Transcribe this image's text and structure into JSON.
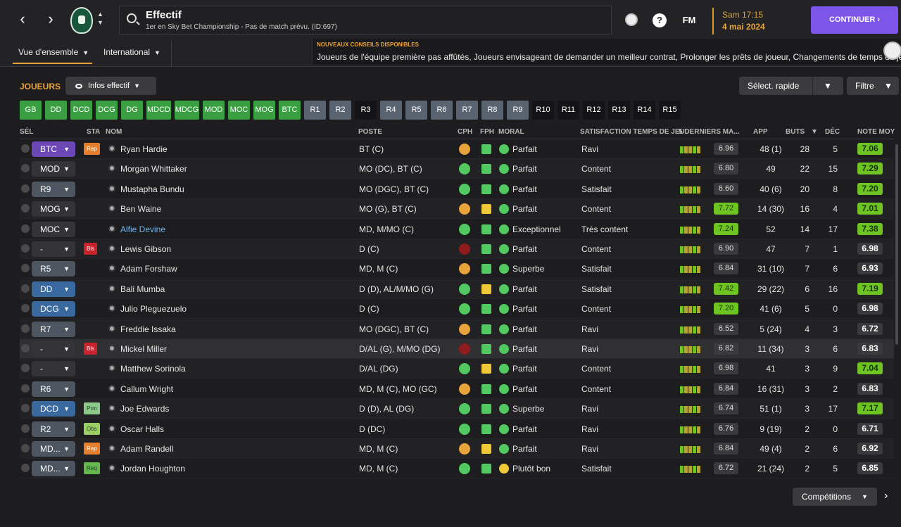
{
  "header": {
    "title": "Effectif",
    "subtitle": "1er en Sky Bet Championship - Pas de match prévu. (ID:697)",
    "time": "Sam 17:15",
    "date": "4 mai 2024",
    "continue_label": "CONTINUER",
    "fm_label": "FM"
  },
  "tabs": [
    {
      "label": "Vue d'ensemble"
    },
    {
      "label": "International"
    }
  ],
  "advice": {
    "title": "NOUVEAUX CONSEILS DISPONIBLES",
    "text": "Joueurs de l'équipe première pas affûtés, Joueurs envisageant de demander un meilleur contrat, Prolonger les prêts de joueur, Changements de temps de jeu"
  },
  "section": {
    "label": "JOUEURS",
    "info": "Infos effectif",
    "quick": "Sélect. rapide",
    "filter": "Filtre",
    "competitions": "Compétitions"
  },
  "positions": [
    "GB",
    "DD",
    "DCD",
    "DCG",
    "DG",
    "MDCD",
    "MDCG",
    "MOD",
    "MOC",
    "MOG",
    "BTC",
    "R1",
    "R2",
    "R3",
    "R4",
    "R5",
    "R6",
    "R7",
    "R8",
    "R9",
    "R10",
    "R11",
    "R12",
    "R13",
    "R14",
    "R15"
  ],
  "columns": {
    "sel": "SÉL",
    "sta": "STA",
    "nom": "NOM",
    "poste": "POSTE",
    "cph": "CPH",
    "fph": "FPH",
    "moral": "MORAL",
    "sat": "SATISFACTION TEMPS DE JEU",
    "form": "5 DERNIERS MA...",
    "app": "APP",
    "buts": "BUTS",
    "dec": "DÉC",
    "note": "NOTE MOY"
  },
  "players": [
    {
      "sel": "BTC",
      "status": "Rep",
      "name": "Ryan Hardie",
      "poste": "BT (C)",
      "moral": "Parfait",
      "sat": "Ravi",
      "form": "6.96",
      "app": "48 (1)",
      "buts": "28",
      "dec": "5",
      "note": "7.06"
    },
    {
      "sel": "MOD",
      "status": "",
      "name": "Morgan Whittaker",
      "poste": "MO (DC), BT (C)",
      "moral": "Parfait",
      "sat": "Content",
      "form": "6.80",
      "app": "49",
      "buts": "22",
      "dec": "15",
      "note": "7.29"
    },
    {
      "sel": "R9",
      "status": "",
      "name": "Mustapha Bundu",
      "poste": "MO (DGC), BT (C)",
      "moral": "Parfait",
      "sat": "Satisfait",
      "form": "6.60",
      "app": "40 (6)",
      "buts": "20",
      "dec": "8",
      "note": "7.20"
    },
    {
      "sel": "MOG",
      "status": "",
      "name": "Ben Waine",
      "poste": "MO (G), BT (C)",
      "moral": "Parfait",
      "sat": "Content",
      "form": "7.72",
      "app": "14 (30)",
      "buts": "16",
      "dec": "4",
      "note": "7.01"
    },
    {
      "sel": "MOC",
      "status": "",
      "name": "Alfie Devine",
      "poste": "MD, M/MO (C)",
      "moral": "Exceptionnel",
      "sat": "Très content",
      "form": "7.24",
      "app": "52",
      "buts": "14",
      "dec": "17",
      "note": "7.38"
    },
    {
      "sel": "-",
      "status": "Bls",
      "name": "Lewis Gibson",
      "poste": "D (C)",
      "moral": "Parfait",
      "sat": "Content",
      "form": "6.90",
      "app": "47",
      "buts": "7",
      "dec": "1",
      "note": "6.98"
    },
    {
      "sel": "R5",
      "status": "",
      "name": "Adam Forshaw",
      "poste": "MD, M (C)",
      "moral": "Superbe",
      "sat": "Satisfait",
      "form": "6.84",
      "app": "31 (10)",
      "buts": "7",
      "dec": "6",
      "note": "6.93"
    },
    {
      "sel": "DD",
      "status": "",
      "name": "Bali Mumba",
      "poste": "D (D), AL/M/MO (G)",
      "moral": "Parfait",
      "sat": "Satisfait",
      "form": "7.42",
      "app": "29 (22)",
      "buts": "6",
      "dec": "16",
      "note": "7.19"
    },
    {
      "sel": "DCG",
      "status": "",
      "name": "Julio Pleguezuelo",
      "poste": "D (C)",
      "moral": "Parfait",
      "sat": "Content",
      "form": "7.20",
      "app": "41 (6)",
      "buts": "5",
      "dec": "0",
      "note": "6.98"
    },
    {
      "sel": "R7",
      "status": "",
      "name": "Freddie Issaka",
      "poste": "MO (DGC), BT (C)",
      "moral": "Parfait",
      "sat": "Ravi",
      "form": "6.52",
      "app": "5 (24)",
      "buts": "4",
      "dec": "3",
      "note": "6.72"
    },
    {
      "sel": "-",
      "status": "Bls",
      "name": "Mickel Miller",
      "poste": "D/AL (G), M/MO (DG)",
      "moral": "Parfait",
      "sat": "Ravi",
      "form": "6.82",
      "app": "11 (34)",
      "buts": "3",
      "dec": "6",
      "note": "6.83"
    },
    {
      "sel": "-",
      "status": "",
      "name": "Matthew Sorinola",
      "poste": "D/AL (DG)",
      "moral": "Parfait",
      "sat": "Content",
      "form": "6.98",
      "app": "41",
      "buts": "3",
      "dec": "9",
      "note": "7.04"
    },
    {
      "sel": "R6",
      "status": "",
      "name": "Callum Wright",
      "poste": "MD, M (C), MO (GC)",
      "moral": "Parfait",
      "sat": "Content",
      "form": "6.84",
      "app": "16 (31)",
      "buts": "3",
      "dec": "2",
      "note": "6.83"
    },
    {
      "sel": "DCD",
      "status": "Prm",
      "name": "Joe Edwards",
      "poste": "D (D), AL (DG)",
      "moral": "Superbe",
      "sat": "Ravi",
      "form": "6.74",
      "app": "51 (1)",
      "buts": "3",
      "dec": "17",
      "note": "7.17"
    },
    {
      "sel": "R2",
      "status": "Obs",
      "name": "Oscar Halls",
      "poste": "D (DC)",
      "moral": "Parfait",
      "sat": "Ravi",
      "form": "6.76",
      "app": "9 (19)",
      "buts": "2",
      "dec": "0",
      "note": "6.71"
    },
    {
      "sel": "MD...",
      "status": "Rep",
      "name": "Adam Randell",
      "poste": "MD, M (C)",
      "moral": "Parfait",
      "sat": "Ravi",
      "form": "6.84",
      "app": "49 (4)",
      "buts": "2",
      "dec": "6",
      "note": "6.92"
    },
    {
      "sel": "MD...",
      "status": "Req",
      "name": "Jordan Houghton",
      "poste": "MD, M (C)",
      "moral": "Plutôt bon",
      "sat": "Satisfait",
      "form": "6.72",
      "app": "21 (24)",
      "buts": "2",
      "dec": "5",
      "note": "6.85"
    }
  ]
}
